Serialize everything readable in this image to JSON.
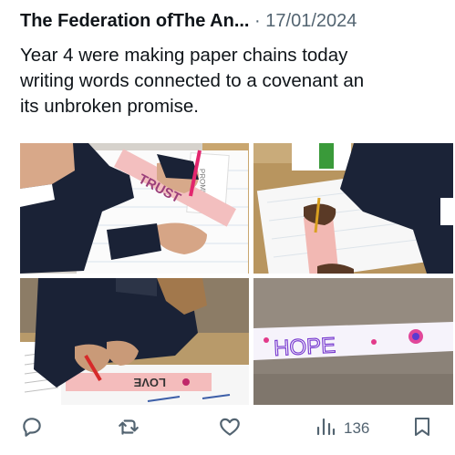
{
  "tweet": {
    "author": "The Federation ofThe An...",
    "separator": "·",
    "date": "17/01/2024",
    "text": "Year 4 were making paper chains today\nwriting words connected to a covenant an\nits unbroken promise."
  },
  "photos": {
    "p1_word": "TRUST",
    "p1_paper": "PROMISE",
    "p3_word": "LOVE",
    "p4_word": "HOPE"
  },
  "actions": {
    "views_count": "136"
  },
  "icons": [
    "reply-icon",
    "retweet-icon",
    "like-icon",
    "views-icon",
    "bookmark-icon"
  ]
}
